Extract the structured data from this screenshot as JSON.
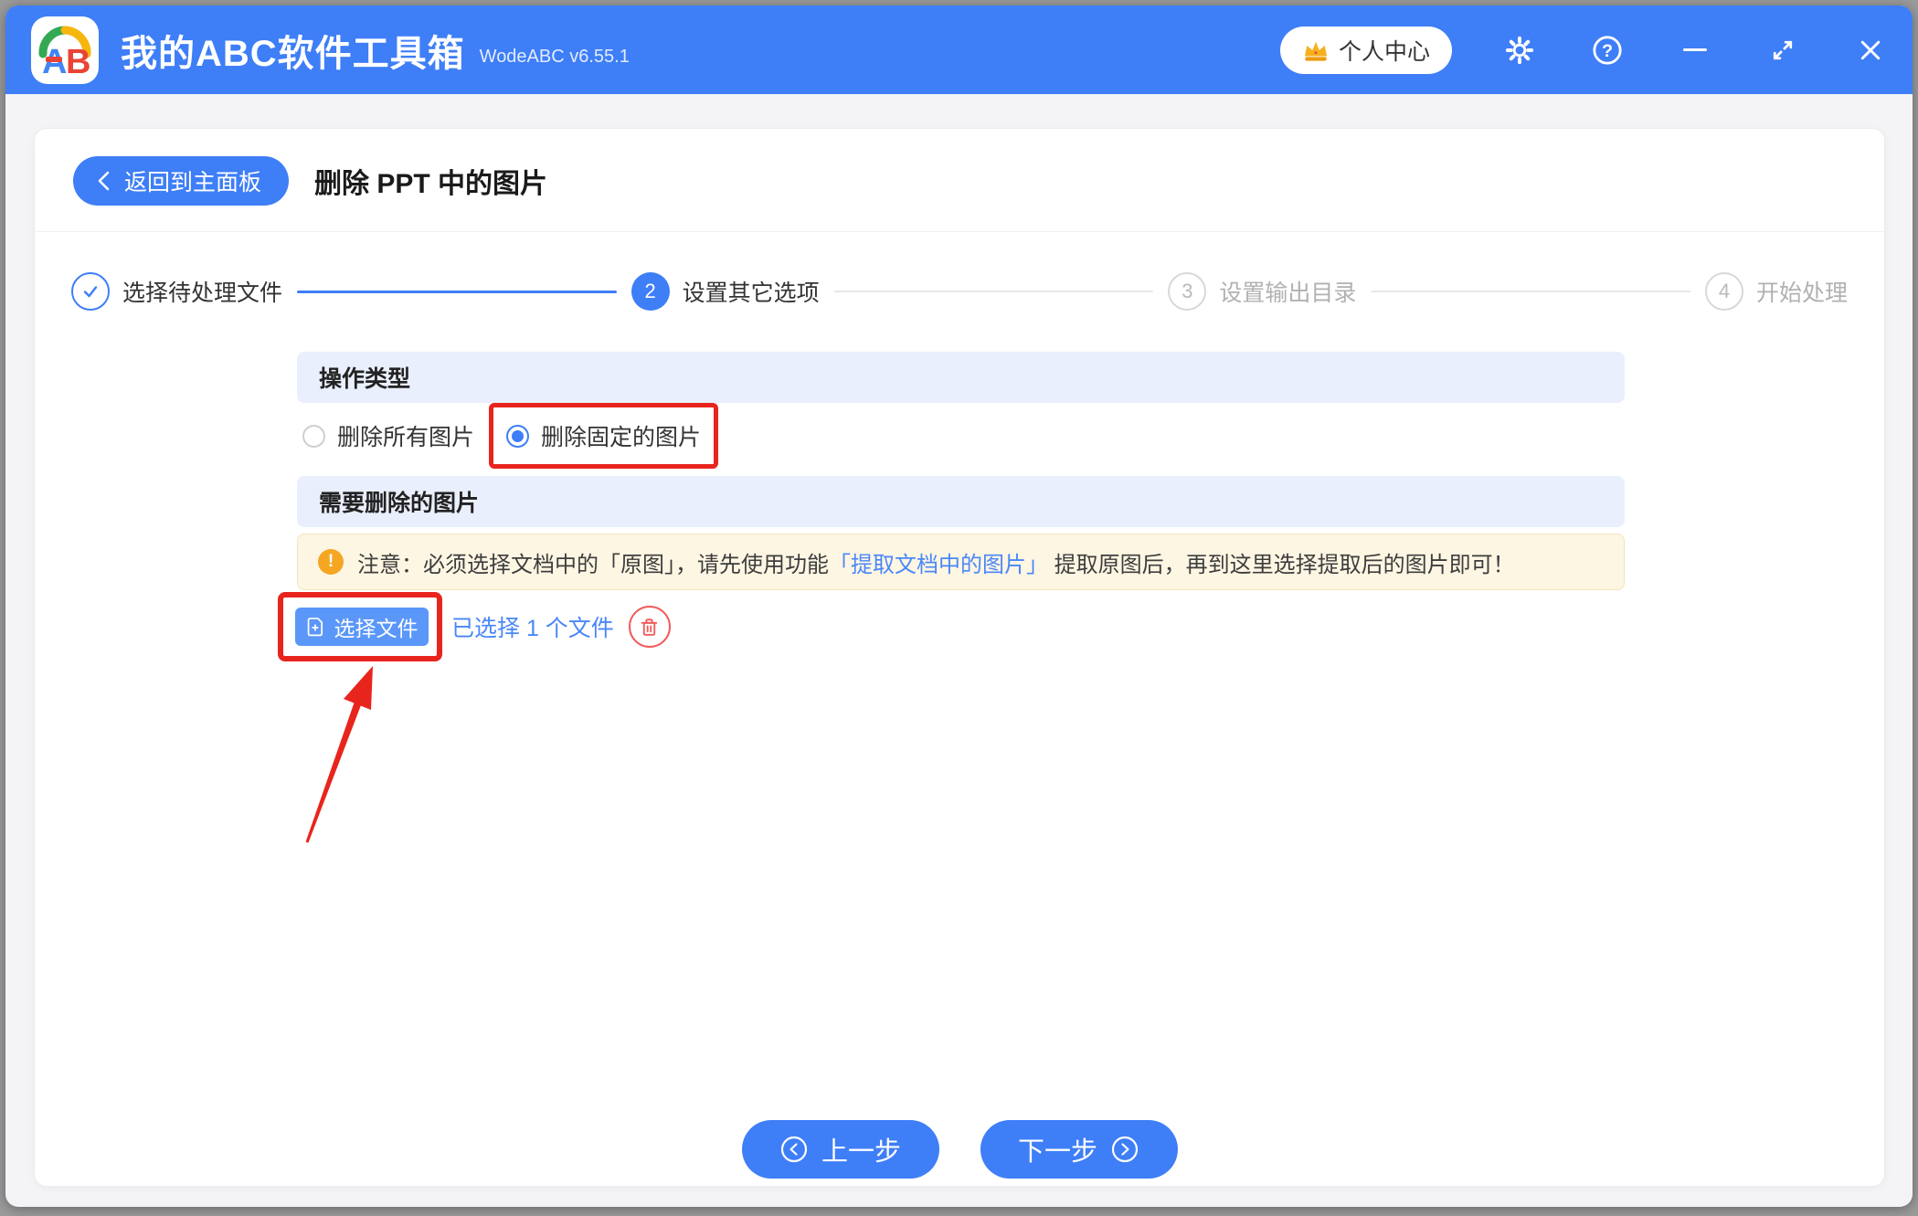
{
  "header": {
    "app_title": "我的ABC软件工具箱",
    "app_version": "WodeABC v6.55.1",
    "user_center": "个人中心"
  },
  "toolbar": {
    "back_label": "返回到主面板",
    "page_title": "删除 PPT 中的图片"
  },
  "steps": [
    {
      "label": "选择待处理文件",
      "state": "done"
    },
    {
      "number": "2",
      "label": "设置其它选项",
      "state": "active"
    },
    {
      "number": "3",
      "label": "设置输出目录",
      "state": "pending"
    },
    {
      "number": "4",
      "label": "开始处理",
      "state": "pending"
    }
  ],
  "operation_type": {
    "title": "操作类型",
    "option_all": "删除所有图片",
    "option_fixed": "删除固定的图片"
  },
  "images_to_delete": {
    "title": "需要删除的图片",
    "notice_prefix": "注意：必须选择文档中的「原图」，请先使用功能",
    "notice_link": "「提取文档中的图片」",
    "notice_suffix": " 提取原图后，再到这里选择提取后的图片即可！",
    "select_file_button": "选择文件",
    "selected_count_text": "已选择 1 个文件"
  },
  "footer": {
    "prev_button": "上一步",
    "next_button": "下一步"
  },
  "icons": {
    "help_glyph": "?",
    "warning_glyph": "!",
    "logo_text": "AB"
  },
  "colors": {
    "accent_blue": "#3E7EF7",
    "select_button_blue": "#5A97F8",
    "link_blue": "#4A87F8",
    "annotation_red": "#E8251D",
    "warning_orange": "#F5A623",
    "section_banner_bg": "#E9EFFC",
    "notice_bg": "#FDF6E3",
    "trash_red": "#F15B5B"
  }
}
